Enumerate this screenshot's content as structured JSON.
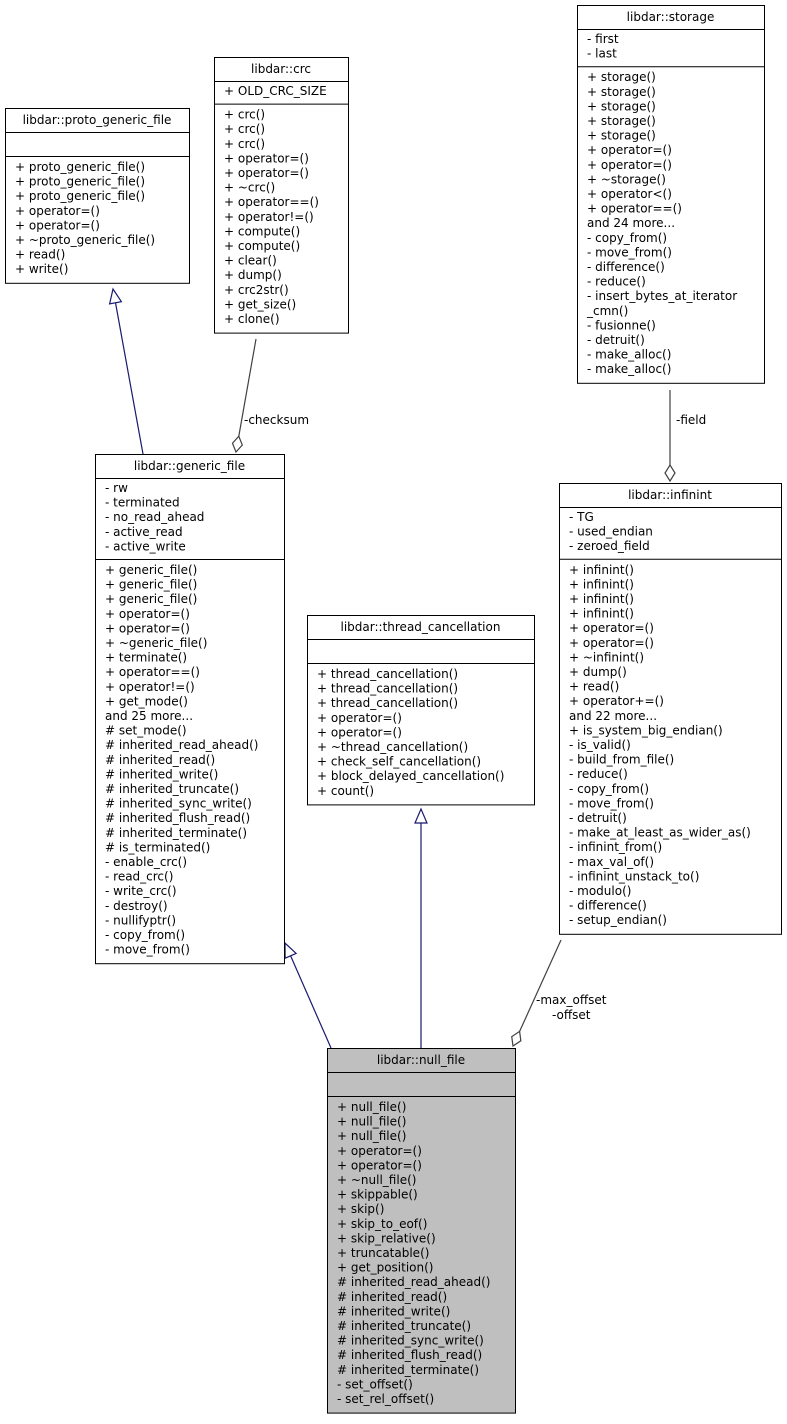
{
  "diagram": {
    "classes": [
      {
        "id": "proto_generic_file",
        "title": "libdar::proto_generic_file",
        "attributes": [],
        "methods": [
          "+ proto_generic_file()",
          "+ proto_generic_file()",
          "+ proto_generic_file()",
          "+ operator=()",
          "+ operator=()",
          "+ ~proto_generic_file()",
          "+ read()",
          "+ write()"
        ]
      },
      {
        "id": "crc",
        "title": "libdar::crc",
        "attributes": [
          "+ OLD_CRC_SIZE"
        ],
        "methods": [
          "+ crc()",
          "+ crc()",
          "+ crc()",
          "+ operator=()",
          "+ operator=()",
          "+ ~crc()",
          "+ operator==()",
          "+ operator!=()",
          "+ compute()",
          "+ compute()",
          "+ clear()",
          "+ dump()",
          "+ crc2str()",
          "+ get_size()",
          "+ clone()"
        ]
      },
      {
        "id": "storage",
        "title": "libdar::storage",
        "attributes": [
          "- first",
          "- last"
        ],
        "methods": [
          "+ storage()",
          "+ storage()",
          "+ storage()",
          "+ storage()",
          "+ storage()",
          "+ operator=()",
          "+ operator=()",
          "+ ~storage()",
          "+ operator<()",
          "+ operator==()",
          "and 24 more...",
          "- copy_from()",
          "- move_from()",
          "- difference()",
          "- reduce()",
          "- insert_bytes_at_iterator",
          "_cmn()",
          "- fusionne()",
          "- detruit()",
          "- make_alloc()",
          "- make_alloc()"
        ]
      },
      {
        "id": "generic_file",
        "title": "libdar::generic_file",
        "attributes": [
          "- rw",
          "- terminated",
          "- no_read_ahead",
          "- active_read",
          "- active_write"
        ],
        "methods": [
          "+ generic_file()",
          "+ generic_file()",
          "+ generic_file()",
          "+ operator=()",
          "+ operator=()",
          "+ ~generic_file()",
          "+ terminate()",
          "+ operator==()",
          "+ operator!=()",
          "+ get_mode()",
          "and 25 more...",
          "# set_mode()",
          "# inherited_read_ahead()",
          "# inherited_read()",
          "# inherited_write()",
          "# inherited_truncate()",
          "# inherited_sync_write()",
          "# inherited_flush_read()",
          "# inherited_terminate()",
          "# is_terminated()",
          "- enable_crc()",
          "- read_crc()",
          "- write_crc()",
          "- destroy()",
          "- nullifyptr()",
          "- copy_from()",
          "- move_from()"
        ]
      },
      {
        "id": "infinint",
        "title": "libdar::infinint",
        "attributes": [
          "- TG",
          "- used_endian",
          "- zeroed_field"
        ],
        "methods": [
          "+ infinint()",
          "+ infinint()",
          "+ infinint()",
          "+ infinint()",
          "+ operator=()",
          "+ operator=()",
          "+ ~infinint()",
          "+ dump()",
          "+ read()",
          "+ operator+=()",
          "and 22 more...",
          "+ is_system_big_endian()",
          "- is_valid()",
          "- build_from_file()",
          "- reduce()",
          "- copy_from()",
          "- move_from()",
          "- detruit()",
          "- make_at_least_as_wider_as()",
          "- infinint_from()",
          "- max_val_of()",
          "- infinint_unstack_to()",
          "- modulo()",
          "- difference()",
          "- setup_endian()"
        ]
      },
      {
        "id": "thread_cancellation",
        "title": "libdar::thread_cancellation",
        "attributes": [],
        "methods": [
          "+ thread_cancellation()",
          "+ thread_cancellation()",
          "+ thread_cancellation()",
          "+ operator=()",
          "+ operator=()",
          "+ ~thread_cancellation()",
          "+ check_self_cancellation()",
          "+ block_delayed_cancellation()",
          "+ count()"
        ]
      },
      {
        "id": "null_file",
        "title": "libdar::null_file",
        "focus": true,
        "attributes": [],
        "methods": [
          "+ null_file()",
          "+ null_file()",
          "+ null_file()",
          "+ operator=()",
          "+ operator=()",
          "+ ~null_file()",
          "+ skippable()",
          "+ skip()",
          "+ skip_to_eof()",
          "+ skip_relative()",
          "+ truncatable()",
          "+ get_position()",
          "# inherited_read_ahead()",
          "# inherited_read()",
          "# inherited_write()",
          "# inherited_truncate()",
          "# inherited_sync_write()",
          "# inherited_flush_read()",
          "# inherited_terminate()",
          "- set_offset()",
          "- set_rel_offset()"
        ]
      }
    ],
    "edges": [
      {
        "from": "generic_file",
        "to": "proto_generic_file",
        "type": "inheritance"
      },
      {
        "from": "crc",
        "to": "generic_file",
        "type": "usage",
        "label": "-checksum"
      },
      {
        "from": "storage",
        "to": "infinint",
        "type": "usage",
        "label": "-field"
      },
      {
        "from": "null_file",
        "to": "generic_file",
        "type": "inheritance"
      },
      {
        "from": "null_file",
        "to": "thread_cancellation",
        "type": "inheritance"
      },
      {
        "from": "infinint",
        "to": "null_file",
        "type": "usage",
        "label": "-max_offset\n-offset"
      }
    ],
    "colors": {
      "inheritance_edge": "#191970",
      "usage_edge": "#404040",
      "focus_fill": "#bfbfbf",
      "box_fill": "#ffffff"
    }
  }
}
